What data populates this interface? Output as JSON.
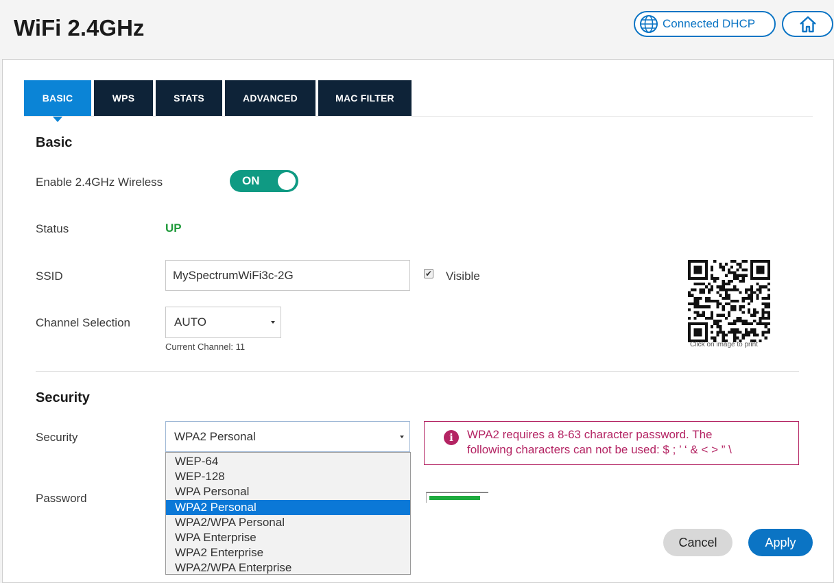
{
  "header": {
    "title": "WiFi 2.4GHz",
    "connection_label": "Connected DHCP",
    "connection_icon": "globe-icon",
    "home_icon": "home-icon"
  },
  "tabs": [
    {
      "label": "BASIC",
      "active": true
    },
    {
      "label": "WPS",
      "active": false
    },
    {
      "label": "STATS",
      "active": false
    },
    {
      "label": "ADVANCED",
      "active": false
    },
    {
      "label": "MAC FILTER",
      "active": false
    }
  ],
  "basic": {
    "heading": "Basic",
    "enable_label": "Enable 2.4GHz Wireless",
    "toggle_state": "ON",
    "status_label": "Status",
    "status_value": "UP",
    "ssid_label": "SSID",
    "ssid_value": "MySpectrumWiFi3c-2G",
    "visible_label": "Visible",
    "visible_checked": true,
    "channel_label": "Channel Selection",
    "channel_value": "AUTO",
    "current_channel": "Current Channel: 11",
    "qr_caption": "Click on image to print"
  },
  "security": {
    "heading": "Security",
    "security_label": "Security",
    "security_value": "WPA2 Personal",
    "options": [
      "WEP-64",
      "WEP-128",
      "WPA Personal",
      "WPA2 Personal",
      "WPA2/WPA Personal",
      "WPA Enterprise",
      "WPA2 Enterprise",
      "WPA2/WPA Enterprise"
    ],
    "selected_index": 3,
    "warning_line1": "WPA2 requires a 8-63 character password. The",
    "warning_line2": "following characters can not be used: $ ; ’ ‘ & < > ” \\",
    "password_label": "Password",
    "password_strength": 0.9
  },
  "actions": {
    "cancel_label": "Cancel",
    "apply_label": "Apply"
  },
  "colors": {
    "accent": "#0b74c4",
    "tab_active": "#0b84d6",
    "tab_inactive": "#0e2338",
    "toggle_on": "#0f9a83",
    "status_up": "#1f9a3a",
    "warning": "#b42463"
  }
}
